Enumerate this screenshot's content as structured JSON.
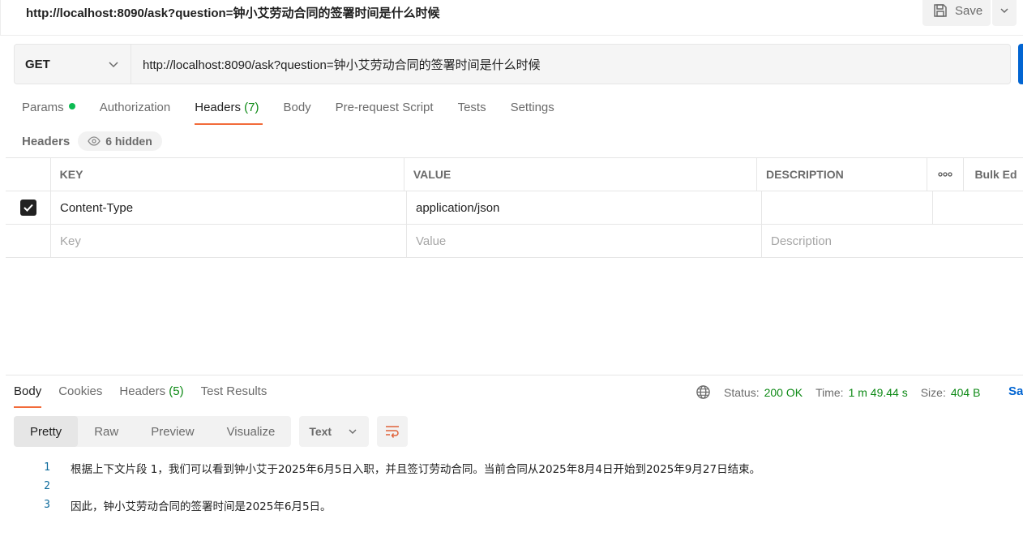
{
  "request": {
    "title": "http://localhost:8090/ask?question=钟小艾劳动合同的签署时间是什么时候",
    "save_label": "Save",
    "method": "GET",
    "url": "http://localhost:8090/ask?question=钟小艾劳动合同的签署时间是什么时候"
  },
  "request_tabs": {
    "params": "Params",
    "authorization": "Authorization",
    "headers": "Headers",
    "headers_count": "(7)",
    "body": "Body",
    "pre_request": "Pre-request Script",
    "tests": "Tests",
    "settings": "Settings"
  },
  "headers_section": {
    "label": "Headers",
    "hidden": "6 hidden"
  },
  "headers_table": {
    "columns": {
      "key": "KEY",
      "value": "VALUE",
      "description": "DESCRIPTION",
      "bulk": "Bulk Ed"
    },
    "rows": [
      {
        "key": "Content-Type",
        "value": "application/json",
        "description": ""
      }
    ],
    "placeholders": {
      "key": "Key",
      "value": "Value",
      "description": "Description"
    }
  },
  "response_tabs": {
    "body": "Body",
    "cookies": "Cookies",
    "headers": "Headers",
    "headers_count": "(5)",
    "test_results": "Test Results"
  },
  "response_status": {
    "status_label": "Status:",
    "status_value": "200 OK",
    "time_label": "Time:",
    "time_value": "1 m 49.44 s",
    "size_label": "Size:",
    "size_value": "404 B",
    "save_label": "Sa"
  },
  "view": {
    "pretty": "Pretty",
    "raw": "Raw",
    "preview": "Preview",
    "visualize": "Visualize",
    "type": "Text"
  },
  "response_body": [
    {
      "line": "1",
      "text": "根据上下文片段 1，我们可以看到钟小艾于2025年6月5日入职，并且签订劳动合同。当前合同从2025年8月4日开始到2025年9月27日结束。"
    },
    {
      "line": "2",
      "text": ""
    },
    {
      "line": "3",
      "text": "因此，钟小艾劳动合同的签署时间是2025年6月5日。"
    }
  ],
  "colors": {
    "accent": "#f26b3a",
    "status_green": "#0e8a16",
    "send_blue": "#0265d2"
  }
}
